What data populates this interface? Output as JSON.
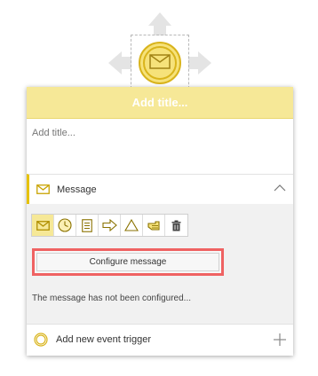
{
  "panel": {
    "title_placeholder": "Add title...",
    "description_placeholder": "Add title..."
  },
  "message_section": {
    "label": "Message",
    "trigger_types": [
      {
        "name": "message",
        "icon": "envelope-icon",
        "active": true
      },
      {
        "name": "timer",
        "icon": "clock-icon",
        "active": false
      },
      {
        "name": "conditional",
        "icon": "document-icon",
        "active": false
      },
      {
        "name": "signal-arrow",
        "icon": "arrow-icon",
        "active": false
      },
      {
        "name": "signal",
        "icon": "triangle-icon",
        "active": false
      },
      {
        "name": "escalation",
        "icon": "hand-icon",
        "active": false
      },
      {
        "name": "delete",
        "icon": "trash-icon",
        "active": false
      }
    ],
    "configure_label": "Configure message",
    "status": "The message has not been configured..."
  },
  "add_trigger": {
    "label": "Add new event trigger"
  },
  "colors": {
    "accent_yellow": "#f6e897",
    "event_gold": "#d9b41c",
    "highlight_red": "#ef6262"
  }
}
